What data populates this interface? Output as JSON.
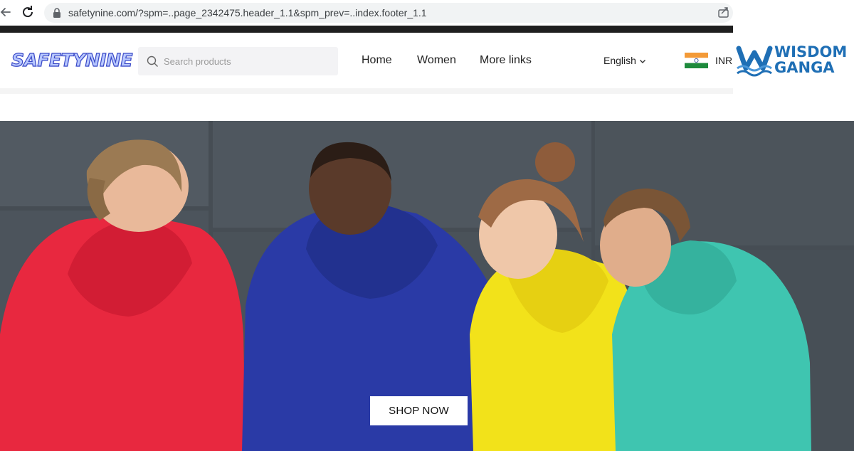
{
  "browser": {
    "url": "safetynine.com/?spm=..page_2342475.header_1.1&spm_prev=..index.footer_1.1"
  },
  "header": {
    "logo_text": "SAFETYNINE",
    "search_placeholder": "Search products",
    "nav": [
      {
        "label": "Home"
      },
      {
        "label": "Women"
      },
      {
        "label": "More links"
      }
    ],
    "language": "English",
    "currency": "INR"
  },
  "watermark": {
    "line1": "WISDOM",
    "line2": "GANGA"
  },
  "hero": {
    "cta_label": "SHOP NOW"
  },
  "colors": {
    "hoodie_red": "#e8283f",
    "hoodie_blue": "#2a3aa6",
    "hoodie_yellow": "#f2e21a",
    "hoodie_teal": "#3fc5b0",
    "wall": "#4a5158",
    "watermark_blue": "#1f6fb5"
  },
  "icons": [
    "back-arrow-icon",
    "reload-icon",
    "lock-icon",
    "share-icon",
    "search-icon",
    "chevron-down-icon",
    "india-flag-icon",
    "wisdom-ganga-logo"
  ]
}
